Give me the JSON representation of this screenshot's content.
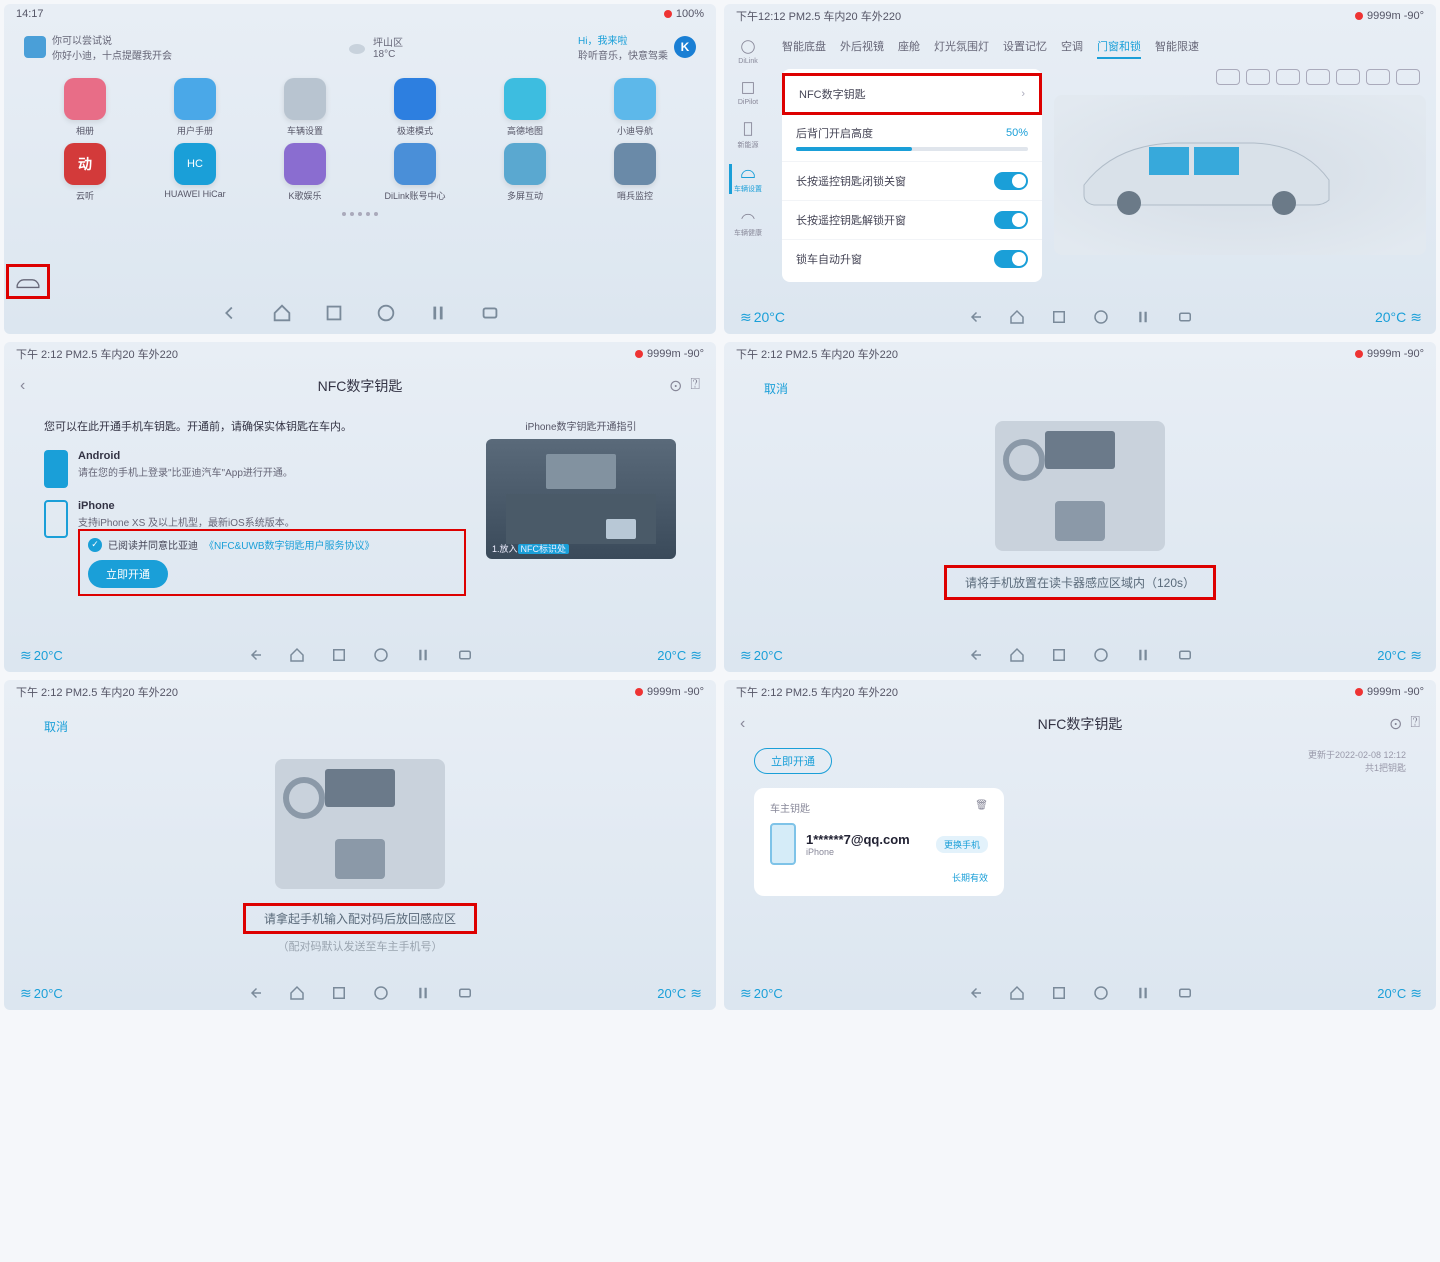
{
  "p1": {
    "status_left": "14:17",
    "status_right": "100%",
    "tip_line1": "你可以尝试说",
    "tip_line2": "你好小迪，十点提醒我开会",
    "weather_loc": "坪山区",
    "weather_temp": "18°C",
    "music_label": "Hi，我来啦",
    "music_sub": "聆听音乐，快意驾乘",
    "apps": [
      {
        "label": "相册",
        "color": "#e86d87"
      },
      {
        "label": "用户手册",
        "color": "#4aa8e8"
      },
      {
        "label": "车辆设置",
        "color": "#b8c4d0"
      },
      {
        "label": "极速模式",
        "color": "#2d7fe0"
      },
      {
        "label": "高德地图",
        "color": "#3dbde0"
      },
      {
        "label": "小迪导航",
        "color": "#5db8ea"
      },
      {
        "label": "云听",
        "color": "#d33a3a"
      },
      {
        "label": "HUAWEI HiCar",
        "color": "#1a9fd8"
      },
      {
        "label": "K歌娱乐",
        "color": "#8a6dd0"
      },
      {
        "label": "DiLink账号中心",
        "color": "#4a8fd8"
      },
      {
        "label": "多屏互动",
        "color": "#5aa8d0"
      },
      {
        "label": "哨兵监控",
        "color": "#6a8aa8"
      }
    ]
  },
  "p2": {
    "status_left": "下午12:12 PM2.5 车内20 车外220",
    "status_right": "9999m -90°",
    "side": [
      "DiLink",
      "DiPilot",
      "新能源",
      "车辆设置",
      "车辆健康"
    ],
    "tabs": [
      "智能底盘",
      "外后视镜",
      "座舱",
      "灯光氛围灯",
      "设置记忆",
      "空调",
      "门窗和锁",
      "智能限速"
    ],
    "active_tab": "门窗和锁",
    "nfc_label": "NFC数字钥匙",
    "height_label": "后背门开启高度",
    "height_value": "50%",
    "toggle1": "长按遥控钥匙闭锁关窗",
    "toggle2": "长按遥控钥匙解锁开窗",
    "toggle3": "锁车自动升窗",
    "temp_left": "20°C",
    "temp_right": "20°C"
  },
  "p3": {
    "status_left": "下午 2:12 PM2.5 车内20 车外220",
    "status_right": "9999m -90°",
    "title": "NFC数字钥匙",
    "intro": "您可以在此开通手机车钥匙。开通前，请确保实体钥匙在车内。",
    "android_name": "Android",
    "android_desc": "请在您的手机上登录\"比亚迪汽车\"App进行开通。",
    "iphone_name": "iPhone",
    "iphone_desc": "支持iPhone XS 及以上机型，最新iOS系统版本。",
    "agree_prefix": "已阅读并同意比亚迪",
    "agree_link": "《NFC&UWB数字钥匙用户服务协议》",
    "open_btn": "立即开通",
    "guide_title": "iPhone数字钥匙开通指引",
    "guide_step_prefix": "1.放入",
    "guide_step_hl": "NFC标识处",
    "temp_left": "20°C",
    "temp_right": "20°C"
  },
  "p4": {
    "status_left": "下午 2:12 PM2.5 车内20 车外220",
    "status_right": "9999m -90°",
    "cancel": "取消",
    "msg": "请将手机放置在读卡器感应区域内（120s）",
    "temp_left": "20°C",
    "temp_right": "20°C"
  },
  "p5": {
    "status_left": "下午 2:12 PM2.5 车内20 车外220",
    "status_right": "9999m -90°",
    "cancel": "取消",
    "msg": "请拿起手机输入配对码后放回感应区",
    "sub": "（配对码默认发送至车主手机号）",
    "temp_left": "20°C",
    "temp_right": "20°C"
  },
  "p6": {
    "status_left": "下午 2:12 PM2.5 车内20 车外220",
    "status_right": "9999m -90°",
    "title": "NFC数字钥匙",
    "open_btn": "立即开通",
    "updated": "更新于2022-02-08 12:12",
    "count": "共1把钥匙",
    "card_title": "车主钥匙",
    "email": "1******7@qq.com",
    "device": "iPhone",
    "chip": "更换手机",
    "validity": "长期有效",
    "temp_left": "20°C",
    "temp_right": "20°C"
  }
}
